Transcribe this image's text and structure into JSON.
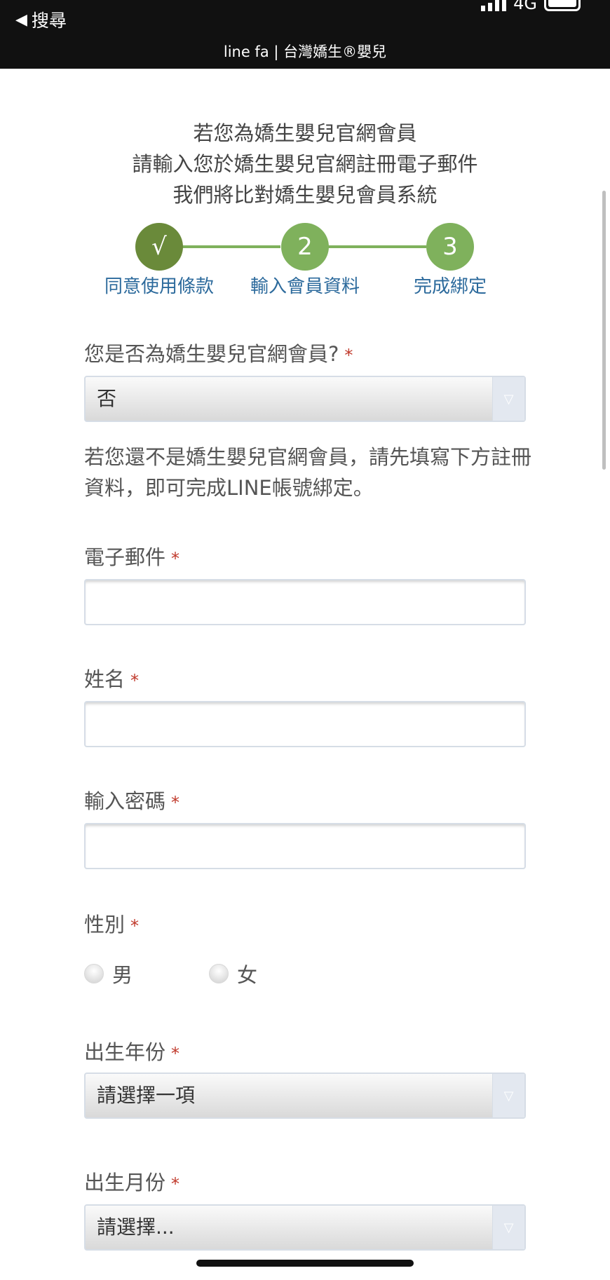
{
  "status_bar": {
    "back_label": "搜尋",
    "network": "4G"
  },
  "header": {
    "title": "line fa | 台灣嬌生®嬰兒"
  },
  "intro": {
    "lines": [
      "若您為嬌生嬰兒官網會員",
      "請輸入您於嬌生嬰兒官網註冊電子郵件",
      "我們將比對嬌生嬰兒會員系統"
    ]
  },
  "steps": [
    {
      "symbol": "√",
      "label": "同意使用條款"
    },
    {
      "symbol": "2",
      "label": "輸入會員資料"
    },
    {
      "symbol": "3",
      "label": "完成綁定"
    }
  ],
  "form": {
    "member_question": {
      "label": "您是否為嬌生嬰兒官網會員?",
      "required_mark": "*",
      "value": "否"
    },
    "note": "若您還不是嬌生嬰兒官網會員，請先填寫下方註冊資料，即可完成LINE帳號綁定。",
    "email": {
      "label": "電子郵件",
      "required_mark": "*",
      "value": ""
    },
    "name": {
      "label": "姓名",
      "required_mark": "*",
      "value": ""
    },
    "password": {
      "label": "輸入密碼",
      "required_mark": "*",
      "value": ""
    },
    "gender": {
      "label": "性別",
      "required_mark": "*",
      "options": [
        "男",
        "女"
      ]
    },
    "birth_year": {
      "label": "出生年份",
      "required_mark": "*",
      "value": "請選擇一項"
    },
    "birth_month": {
      "label": "出生月份",
      "required_mark": "*",
      "value": "請選擇..."
    }
  },
  "icons": {
    "dropdown_arrow": "▽",
    "back_arrow": "◀"
  },
  "colors": {
    "step_active": "#7fb15c",
    "step_done": "#6a8a3a",
    "step_label": "#2c6a9c",
    "required": "#c0392b"
  }
}
